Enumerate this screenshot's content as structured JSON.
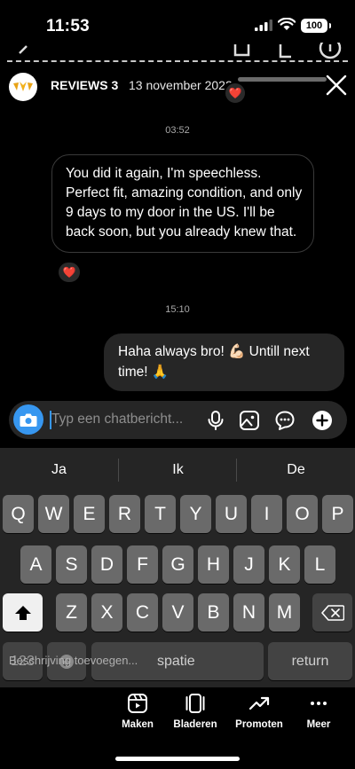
{
  "status_bar": {
    "time": "11:53",
    "battery": "100"
  },
  "story": {
    "account_name": "REVIEWS 3",
    "date": "13 november 2022"
  },
  "messages": [
    {
      "timestamp": "03:52",
      "text": "You did it again,  I'm speechless. Perfect fit, amazing condition,  and only 9 days to my door in the US. I'll be back soon, but you already knew that.",
      "reaction": "❤️"
    },
    {
      "timestamp": "15:10",
      "text": "Haha always bro! 💪🏻 Untill next time! 🙏"
    }
  ],
  "header_reaction": "❤️",
  "input": {
    "placeholder": "Typ een chatbericht..."
  },
  "keyboard": {
    "suggestions": [
      "Ja",
      "Ik",
      "De"
    ],
    "row1": [
      "Q",
      "W",
      "E",
      "R",
      "T",
      "Y",
      "U",
      "I",
      "O",
      "P"
    ],
    "row2": [
      "A",
      "S",
      "D",
      "F",
      "G",
      "H",
      "J",
      "K",
      "L"
    ],
    "row3": [
      "Z",
      "X",
      "C",
      "V",
      "B",
      "N",
      "M"
    ],
    "numbers_key": "123",
    "dictation_hint": "Beschrijving toevoegen...",
    "space_key": "spatie",
    "return_key": "return"
  },
  "actions": [
    {
      "label": "Maken",
      "icon": "reels-icon"
    },
    {
      "label": "Bladeren",
      "icon": "browse-icon"
    },
    {
      "label": "Promoten",
      "icon": "trend-icon"
    },
    {
      "label": "Meer",
      "icon": "more-icon"
    }
  ],
  "colors": {
    "accent": "#3797f0",
    "bubble_out": "#262626",
    "keyboard_bg": "#252525",
    "key": "#6a6a6a"
  }
}
